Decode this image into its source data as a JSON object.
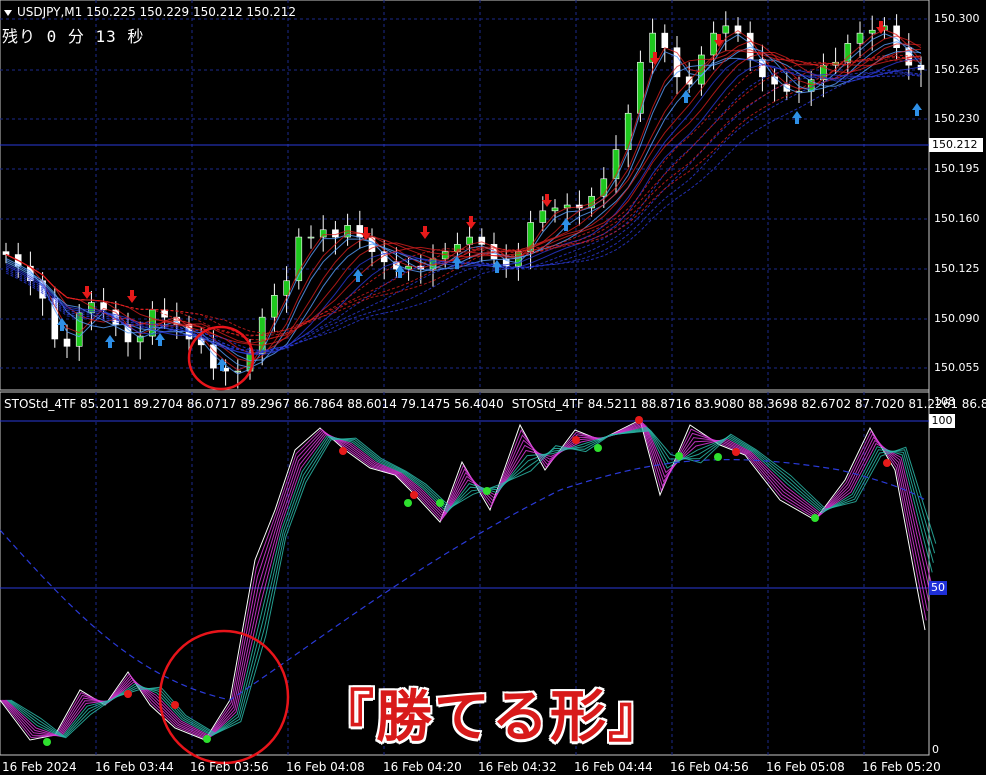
{
  "symbol_header": "USDJPY,M1  150.225 150.229 150.212 150.212",
  "timer": "残り 0 分 13 秒",
  "current_price": "150.212",
  "price_ticks": [
    "150.300",
    "150.265",
    "150.230",
    "150.195",
    "150.160",
    "150.125",
    "150.090",
    "150.055"
  ],
  "stoch_header": {
    "part1": "STOStd_4TF 85.2011 89.2704 86.0717 89.2967 86.7864 88.6014 79.1475 56.4040",
    "part2": "STOStd_4TF 84.5211 88.8716 83.9080 88.3698 82.6702 87.7020 81.2261 86.8"
  },
  "stoch_scale": {
    "top": "108",
    "max": "100",
    "mid": "50",
    "bottom": "0"
  },
  "time_labels": [
    "16 Feb 2024",
    "16 Feb 03:44",
    "16 Feb 03:56",
    "16 Feb 04:08",
    "16 Feb 04:20",
    "16 Feb 04:32",
    "16 Feb 04:44",
    "16 Feb 04:56",
    "16 Feb 05:08",
    "16 Feb 05:20"
  ],
  "banner": "『勝てる形』",
  "colors": {
    "background": "#000000",
    "grid": "#1b2a8c",
    "bull_candle": "#1ec81e",
    "bear_candle": "#ffffff",
    "up_arrow": "#2e8fe6",
    "down_arrow": "#e61a1a",
    "highlight_circle": "#e8141a"
  },
  "icons": {
    "down_arrow": "red-down-arrow-icon",
    "up_arrow": "blue-up-arrow-icon"
  },
  "chart_data": {
    "type": "candlestick",
    "series": [
      {
        "name": "USDJPY,M1",
        "close": [
          150.138,
          150.13,
          150.12,
          150.108,
          150.08,
          150.075,
          150.098,
          150.105,
          150.1,
          150.09,
          150.078,
          150.082,
          150.1,
          150.095,
          150.09,
          150.08,
          150.076,
          150.06,
          150.058,
          150.058,
          150.07,
          150.095,
          150.11,
          150.12,
          150.15,
          150.15,
          150.155,
          150.15,
          150.158,
          150.15,
          150.14,
          150.133,
          150.128,
          150.13,
          150.128,
          150.135,
          150.14,
          150.145,
          150.15,
          150.145,
          150.135,
          150.13,
          150.14,
          150.16,
          150.168,
          150.17,
          150.172,
          150.17,
          150.178,
          150.19,
          150.21,
          150.235,
          150.27,
          150.29,
          150.28,
          150.26,
          150.255,
          150.275,
          150.29,
          150.295,
          150.29,
          150.272,
          150.26,
          150.255,
          150.25,
          150.25,
          150.258,
          150.268,
          150.27,
          150.283,
          150.29,
          150.292,
          150.295,
          150.28,
          150.268,
          150.265
        ]
      }
    ],
    "ylim": [
      150.045,
      150.31
    ]
  }
}
